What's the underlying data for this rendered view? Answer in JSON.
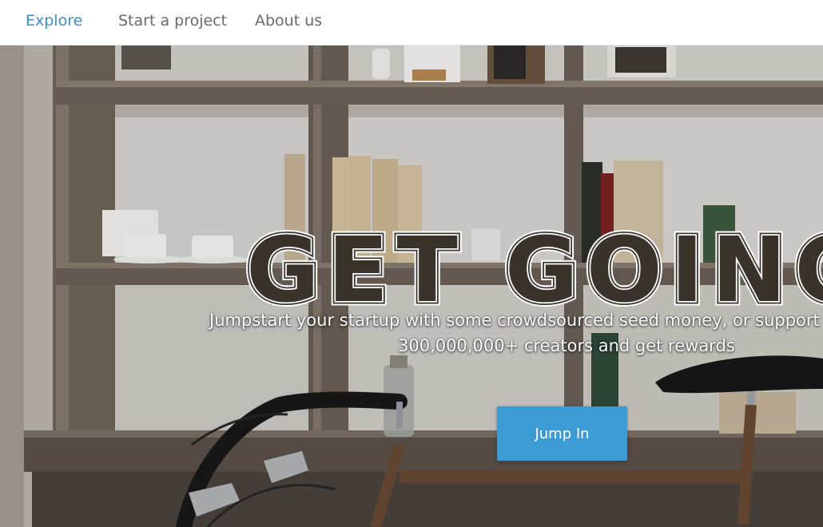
{
  "nav": {
    "items": [
      {
        "label": "Explore",
        "active": true
      },
      {
        "label": "Start a project",
        "active": false
      },
      {
        "label": "About us",
        "active": false
      }
    ]
  },
  "hero": {
    "headline": "GET GOING",
    "tagline_line1": "Jumpstart your startup with some crowdsourced seed money, or support",
    "tagline_line2": "300,000,000+ creators and get rewards",
    "cta_label": "Jump In",
    "background_scene": "wooden bookshelf with books, cups and a bicycle"
  },
  "colors": {
    "accent": "#3d8fc6",
    "button": "#3d9bd4",
    "nav_text": "#6a6a6a",
    "hero_text": "#ffffff"
  }
}
